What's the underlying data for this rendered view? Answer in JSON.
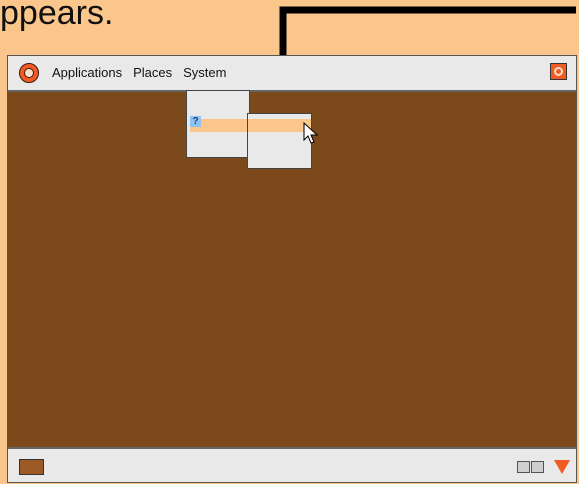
{
  "caption": {
    "text": "ppears."
  },
  "top_panel": {
    "menus": [
      "Applications",
      "Places",
      "System"
    ]
  },
  "icons": {
    "app_logo": "gnome-foot-icon",
    "shutdown": "power-icon",
    "help": "help-icon",
    "show_desktop": "show-desktop-icon",
    "workspace": "workspace-switcher-icon",
    "trash": "trash-icon",
    "pointer": "mouse-pointer-icon",
    "arrow": "down-arrow-icon"
  },
  "menu": {
    "help_icon_text": "?"
  },
  "colors": {
    "desktop": "#7c4a1a",
    "panel": "#e9e9e9",
    "highlight": "#fbc68c",
    "accent": "#f15a24",
    "background": "#fbc68c"
  }
}
